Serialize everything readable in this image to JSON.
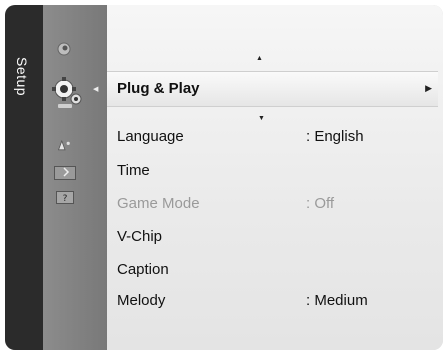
{
  "sidebar": {
    "title": "Setup"
  },
  "icons": [
    "picture-icon",
    "setup-icon",
    "input-icon",
    "application-icon",
    "support-icon"
  ],
  "selected": {
    "label": "Plug & Play"
  },
  "menu": [
    {
      "label": "Language",
      "value": ": English",
      "enabled": true
    },
    {
      "label": "Time",
      "value": "",
      "enabled": true
    },
    {
      "label": "Game Mode",
      "value": ": Off",
      "enabled": false
    },
    {
      "label": "V-Chip",
      "value": "",
      "enabled": true
    },
    {
      "label": "Caption",
      "value": "",
      "enabled": true
    },
    {
      "label": "Melody",
      "value": ": Medium",
      "enabled": true
    }
  ],
  "colors": {
    "tab": "#2b2b2b",
    "icon_bar": "#808080",
    "list_bg": "#ececec",
    "disabled": "#9a9a9a"
  }
}
